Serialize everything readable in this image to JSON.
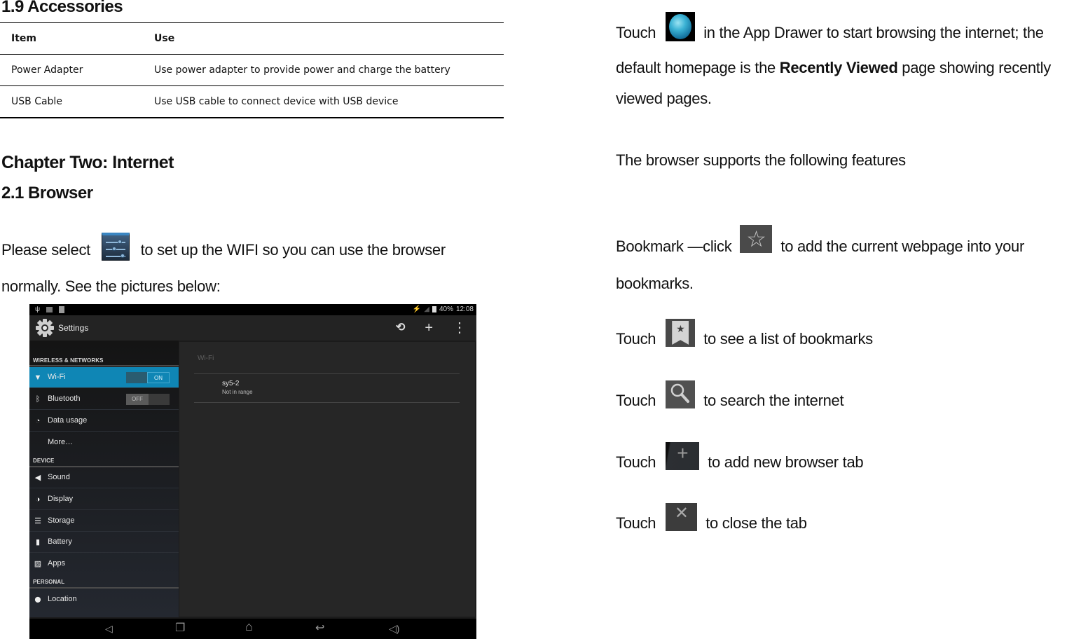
{
  "accessories": {
    "heading": "1.9 Accessories",
    "columns": [
      "Item",
      "Use"
    ],
    "rows": [
      [
        "Power Adapter",
        "Use power adapter to provide power and charge the battery"
      ],
      [
        "USB Cable",
        "Use USB cable to connect device with USB device"
      ]
    ]
  },
  "chapter": {
    "title": "Chapter Two: Internet",
    "section": "2.1 Browser",
    "intro_before_icon": "Please select",
    "intro_icon": "settings-sliders-icon",
    "intro_after_icon": "to set up the WIFI so you can use the browser",
    "intro_line2": "normally. See the pictures below:"
  },
  "android": {
    "status_bar": {
      "left_icons": [
        "usb-icon",
        "image-icon",
        "sd-card-icon"
      ],
      "right_icons": [
        "no-signal-icon",
        "signal-icon",
        "battery-icon"
      ],
      "battery": "40%",
      "time": "12:08"
    },
    "action_bar": {
      "title": "Settings",
      "actions": [
        "wps-icon",
        "add-icon",
        "overflow-menu-icon"
      ],
      "action_glyphs": [
        "⟲",
        "+",
        "⋮"
      ]
    },
    "sidebar": {
      "sections": [
        {
          "header": "WIRELESS & NETWORKS",
          "items": [
            {
              "label": "Wi-Fi",
              "icon": "wifi-icon",
              "glyph": "▼",
              "toggle": "ON",
              "active": true
            },
            {
              "label": "Bluetooth",
              "icon": "bluetooth-icon",
              "glyph": "ᛒ",
              "toggle": "OFF"
            },
            {
              "label": "Data usage",
              "icon": "data-usage-icon",
              "glyph": "◔"
            },
            {
              "label": "More…",
              "icon": "",
              "glyph": ""
            }
          ]
        },
        {
          "header": "DEVICE",
          "items": [
            {
              "label": "Sound",
              "icon": "sound-icon",
              "glyph": "◀"
            },
            {
              "label": "Display",
              "icon": "display-icon",
              "glyph": "◑"
            },
            {
              "label": "Storage",
              "icon": "storage-icon",
              "glyph": "☰"
            },
            {
              "label": "Battery",
              "icon": "battery-icon",
              "glyph": "▮"
            },
            {
              "label": "Apps",
              "icon": "apps-icon",
              "glyph": "▨"
            }
          ]
        },
        {
          "header": "PERSONAL",
          "items": [
            {
              "label": "Location",
              "icon": "location-icon",
              "glyph": "⬤"
            }
          ]
        }
      ]
    },
    "detail": {
      "title": "Wi-Fi",
      "networks": [
        {
          "name": "sy5-2",
          "status": "Not in range"
        }
      ]
    },
    "nav_bar": {
      "buttons": [
        "volume-down-icon",
        "recent-apps-icon",
        "home-icon",
        "back-icon",
        "volume-up-icon"
      ],
      "glyphs": [
        "◁",
        "❐",
        "⌂",
        "↩",
        "◁)"
      ]
    }
  },
  "browser_guide": {
    "p1": {
      "before_icon": "Touch",
      "icon": "browser-globe-icon",
      "after_icon": "in the App Drawer to start browsing the internet; the",
      "line2_before_bold": "default homepage is the",
      "line2_bold": "Recently Viewed",
      "line2_after_bold": "page showing recently",
      "line3": "viewed pages."
    },
    "features_intro": "The browser supports the following features",
    "bookmark": {
      "before_icon": "Bookmark —click",
      "icon": "bookmark-star-icon",
      "after_icon": "to add the current webpage into your",
      "line2": "bookmarks."
    },
    "features": [
      {
        "before_icon": "Touch",
        "icon": "bookmarks-list-icon",
        "after_icon": "to see a list of bookmarks"
      },
      {
        "before_icon": "Touch",
        "icon": "search-icon",
        "after_icon": "to search the internet"
      },
      {
        "before_icon": "Touch",
        "icon": "new-tab-icon",
        "after_icon": "to add new browser tab"
      },
      {
        "before_icon": "Touch",
        "icon": "close-tab-icon",
        "after_icon": "to close the tab"
      }
    ]
  }
}
